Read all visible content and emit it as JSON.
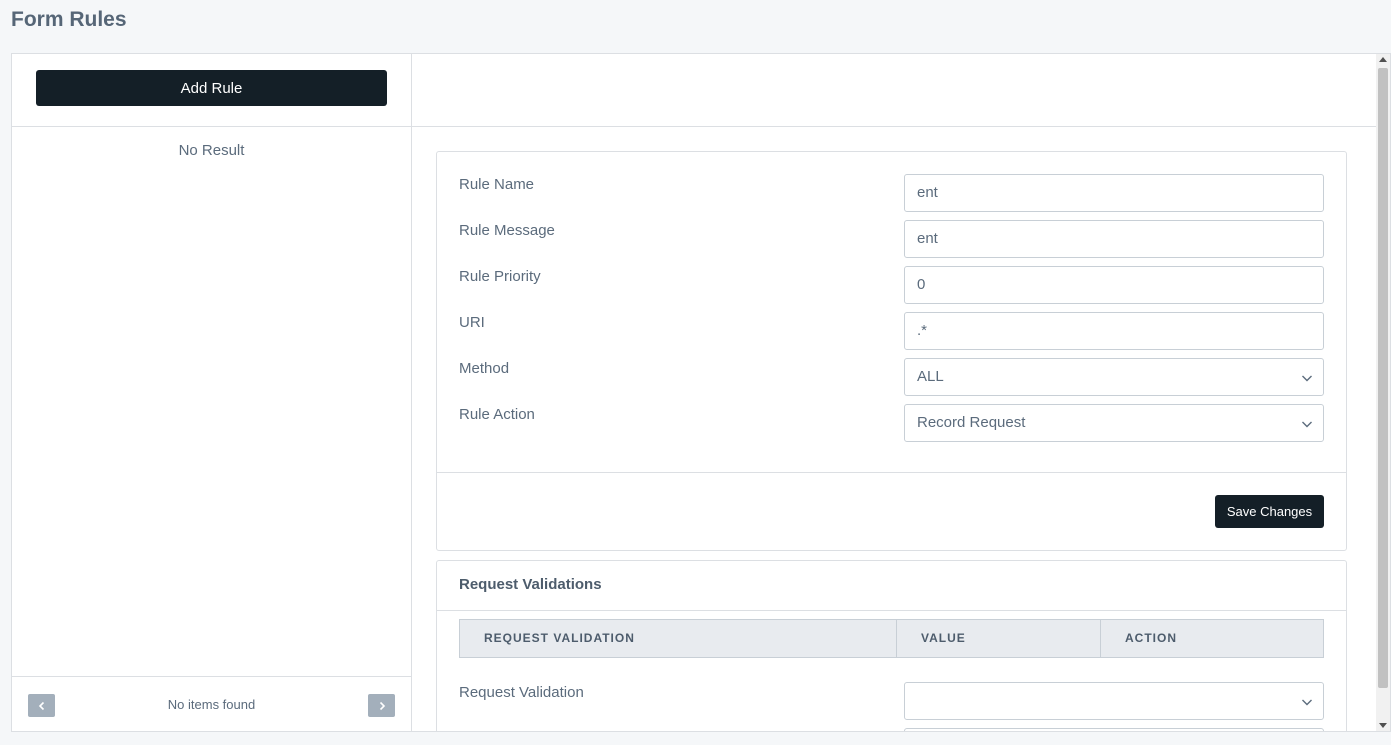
{
  "page": {
    "title": "Form Rules"
  },
  "left_panel": {
    "add_rule_label": "Add Rule",
    "empty_text": "No Result",
    "pagination": {
      "status": "No items found"
    }
  },
  "rule_form": {
    "fields": [
      {
        "label": "Rule Name",
        "value": "ent"
      },
      {
        "label": "Rule Message",
        "value": "ent"
      },
      {
        "label": "Rule Priority",
        "value": "0"
      },
      {
        "label": "URI",
        "value": ".*"
      },
      {
        "label": "Method",
        "value": "ALL"
      },
      {
        "label": "Rule Action",
        "value": "Record Request"
      }
    ],
    "save_label": "Save Changes"
  },
  "request_validations": {
    "title": "Request Validations",
    "columns": [
      "REQUEST VALIDATION",
      "VALUE",
      "ACTION"
    ],
    "field": {
      "label": "Request Validation",
      "value": ""
    }
  },
  "icons": {
    "prev": "chevron-left-icon",
    "next": "chevron-right-icon",
    "select": "chevron-down-icon"
  },
  "colors": {
    "primary_button": "#141f27",
    "pager_button": "#a3afbb",
    "table_header": "#e8ebef"
  }
}
